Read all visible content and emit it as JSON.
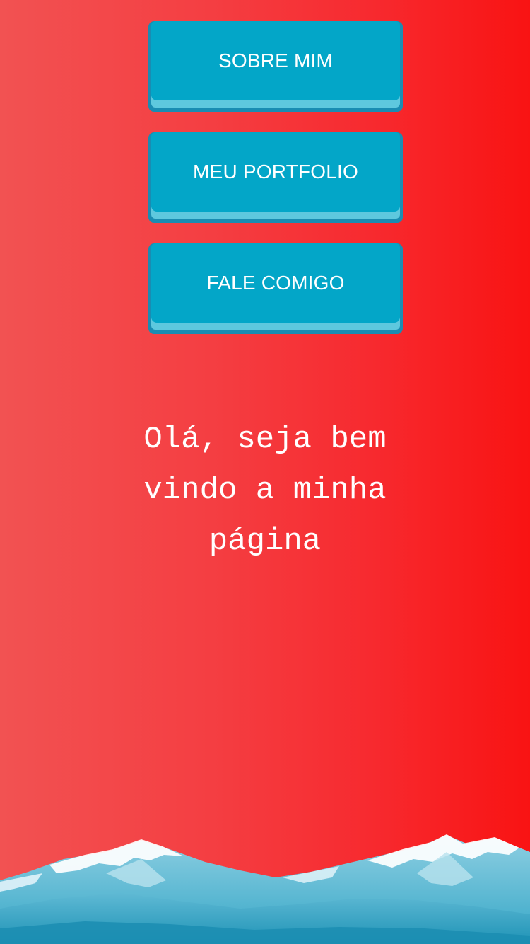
{
  "nav": {
    "buttons": [
      {
        "label": "SOBRE MIM"
      },
      {
        "label": "MEU PORTFOLIO"
      },
      {
        "label": "FALE COMIGO"
      }
    ]
  },
  "main": {
    "greeting": "Olá, seja bem vindo a minha página"
  },
  "colors": {
    "background_left": "#f25252",
    "background_right": "#f91313",
    "button_face": "#03a6c8",
    "button_lip": "#5ec8de",
    "text": "#ffffff"
  },
  "decor": {
    "footer_image": "snowy-mountains-illustration"
  }
}
